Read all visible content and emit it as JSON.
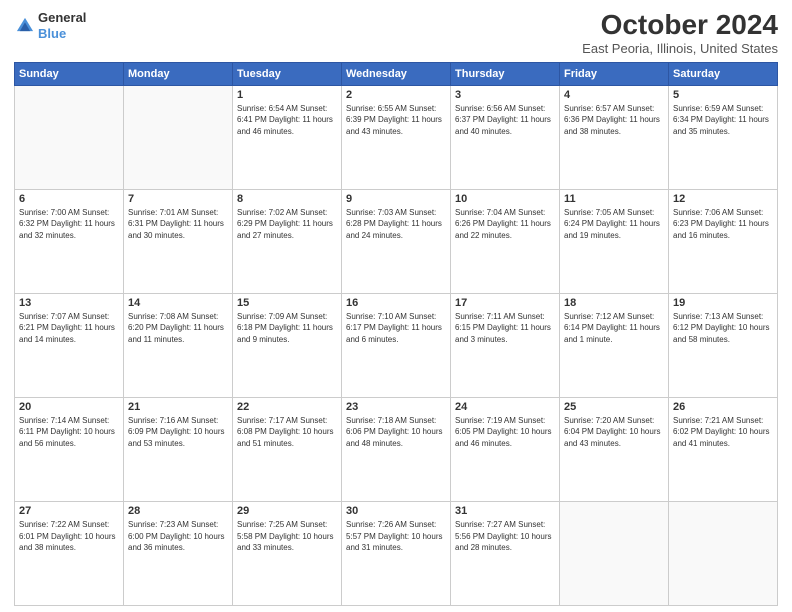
{
  "logo": {
    "general": "General",
    "blue": "Blue"
  },
  "title": "October 2024",
  "subtitle": "East Peoria, Illinois, United States",
  "weekdays": [
    "Sunday",
    "Monday",
    "Tuesday",
    "Wednesday",
    "Thursday",
    "Friday",
    "Saturday"
  ],
  "weeks": [
    [
      {
        "day": "",
        "details": ""
      },
      {
        "day": "",
        "details": ""
      },
      {
        "day": "1",
        "details": "Sunrise: 6:54 AM\nSunset: 6:41 PM\nDaylight: 11 hours and 46 minutes."
      },
      {
        "day": "2",
        "details": "Sunrise: 6:55 AM\nSunset: 6:39 PM\nDaylight: 11 hours and 43 minutes."
      },
      {
        "day": "3",
        "details": "Sunrise: 6:56 AM\nSunset: 6:37 PM\nDaylight: 11 hours and 40 minutes."
      },
      {
        "day": "4",
        "details": "Sunrise: 6:57 AM\nSunset: 6:36 PM\nDaylight: 11 hours and 38 minutes."
      },
      {
        "day": "5",
        "details": "Sunrise: 6:59 AM\nSunset: 6:34 PM\nDaylight: 11 hours and 35 minutes."
      }
    ],
    [
      {
        "day": "6",
        "details": "Sunrise: 7:00 AM\nSunset: 6:32 PM\nDaylight: 11 hours and 32 minutes."
      },
      {
        "day": "7",
        "details": "Sunrise: 7:01 AM\nSunset: 6:31 PM\nDaylight: 11 hours and 30 minutes."
      },
      {
        "day": "8",
        "details": "Sunrise: 7:02 AM\nSunset: 6:29 PM\nDaylight: 11 hours and 27 minutes."
      },
      {
        "day": "9",
        "details": "Sunrise: 7:03 AM\nSunset: 6:28 PM\nDaylight: 11 hours and 24 minutes."
      },
      {
        "day": "10",
        "details": "Sunrise: 7:04 AM\nSunset: 6:26 PM\nDaylight: 11 hours and 22 minutes."
      },
      {
        "day": "11",
        "details": "Sunrise: 7:05 AM\nSunset: 6:24 PM\nDaylight: 11 hours and 19 minutes."
      },
      {
        "day": "12",
        "details": "Sunrise: 7:06 AM\nSunset: 6:23 PM\nDaylight: 11 hours and 16 minutes."
      }
    ],
    [
      {
        "day": "13",
        "details": "Sunrise: 7:07 AM\nSunset: 6:21 PM\nDaylight: 11 hours and 14 minutes."
      },
      {
        "day": "14",
        "details": "Sunrise: 7:08 AM\nSunset: 6:20 PM\nDaylight: 11 hours and 11 minutes."
      },
      {
        "day": "15",
        "details": "Sunrise: 7:09 AM\nSunset: 6:18 PM\nDaylight: 11 hours and 9 minutes."
      },
      {
        "day": "16",
        "details": "Sunrise: 7:10 AM\nSunset: 6:17 PM\nDaylight: 11 hours and 6 minutes."
      },
      {
        "day": "17",
        "details": "Sunrise: 7:11 AM\nSunset: 6:15 PM\nDaylight: 11 hours and 3 minutes."
      },
      {
        "day": "18",
        "details": "Sunrise: 7:12 AM\nSunset: 6:14 PM\nDaylight: 11 hours and 1 minute."
      },
      {
        "day": "19",
        "details": "Sunrise: 7:13 AM\nSunset: 6:12 PM\nDaylight: 10 hours and 58 minutes."
      }
    ],
    [
      {
        "day": "20",
        "details": "Sunrise: 7:14 AM\nSunset: 6:11 PM\nDaylight: 10 hours and 56 minutes."
      },
      {
        "day": "21",
        "details": "Sunrise: 7:16 AM\nSunset: 6:09 PM\nDaylight: 10 hours and 53 minutes."
      },
      {
        "day": "22",
        "details": "Sunrise: 7:17 AM\nSunset: 6:08 PM\nDaylight: 10 hours and 51 minutes."
      },
      {
        "day": "23",
        "details": "Sunrise: 7:18 AM\nSunset: 6:06 PM\nDaylight: 10 hours and 48 minutes."
      },
      {
        "day": "24",
        "details": "Sunrise: 7:19 AM\nSunset: 6:05 PM\nDaylight: 10 hours and 46 minutes."
      },
      {
        "day": "25",
        "details": "Sunrise: 7:20 AM\nSunset: 6:04 PM\nDaylight: 10 hours and 43 minutes."
      },
      {
        "day": "26",
        "details": "Sunrise: 7:21 AM\nSunset: 6:02 PM\nDaylight: 10 hours and 41 minutes."
      }
    ],
    [
      {
        "day": "27",
        "details": "Sunrise: 7:22 AM\nSunset: 6:01 PM\nDaylight: 10 hours and 38 minutes."
      },
      {
        "day": "28",
        "details": "Sunrise: 7:23 AM\nSunset: 6:00 PM\nDaylight: 10 hours and 36 minutes."
      },
      {
        "day": "29",
        "details": "Sunrise: 7:25 AM\nSunset: 5:58 PM\nDaylight: 10 hours and 33 minutes."
      },
      {
        "day": "30",
        "details": "Sunrise: 7:26 AM\nSunset: 5:57 PM\nDaylight: 10 hours and 31 minutes."
      },
      {
        "day": "31",
        "details": "Sunrise: 7:27 AM\nSunset: 5:56 PM\nDaylight: 10 hours and 28 minutes."
      },
      {
        "day": "",
        "details": ""
      },
      {
        "day": "",
        "details": ""
      }
    ]
  ]
}
